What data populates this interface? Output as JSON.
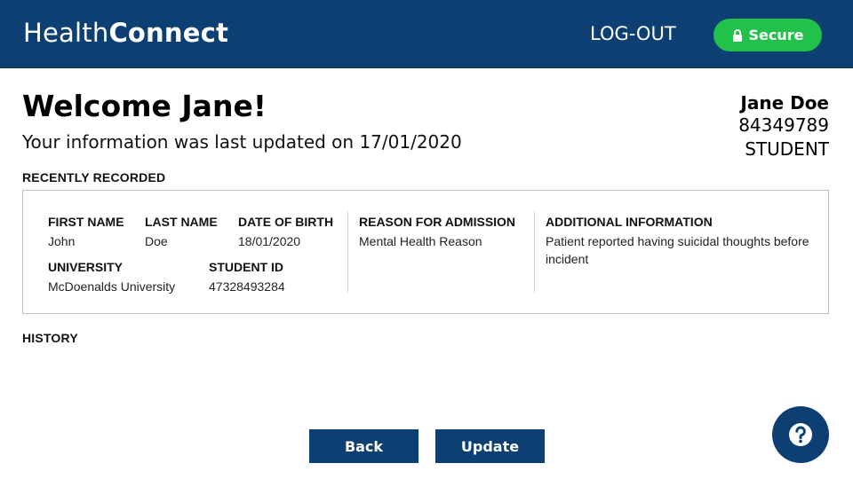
{
  "header": {
    "brand_light": "Health",
    "brand_bold": "Connect",
    "logout_label": "LOG-OUT",
    "secure_label": "Secure",
    "secure_icon": "lock-icon"
  },
  "welcome": {
    "title": "Welcome Jane!",
    "subtitle": "Your information was last updated on 17/01/2020"
  },
  "user": {
    "name": "Jane Doe",
    "id": "84349789",
    "role": "STUDENT"
  },
  "recent": {
    "title": "RECENTLY RECORDED",
    "first_name_label": "FIRST NAME",
    "first_name": "John",
    "last_name_label": "LAST NAME",
    "last_name": "Doe",
    "dob_label": "DATE OF BIRTH",
    "dob": "18/01/2020",
    "university_label": "UNIVERSITY",
    "university": "McDoenalds University",
    "student_id_label": "STUDENT ID",
    "student_id": "47328493284",
    "reason_label": "REASON FOR ADMISSION",
    "reason": "Mental Health Reason",
    "info_label": "ADDITIONAL INFORMATION",
    "info": "Patient reported having suicidal thoughts before incident"
  },
  "history": {
    "title": "HISTORY"
  },
  "actions": {
    "back_label": "Back",
    "update_label": "Update",
    "help_icon": "help-icon"
  },
  "colors": {
    "primary": "#0d3f73",
    "secure": "#22c24a"
  }
}
